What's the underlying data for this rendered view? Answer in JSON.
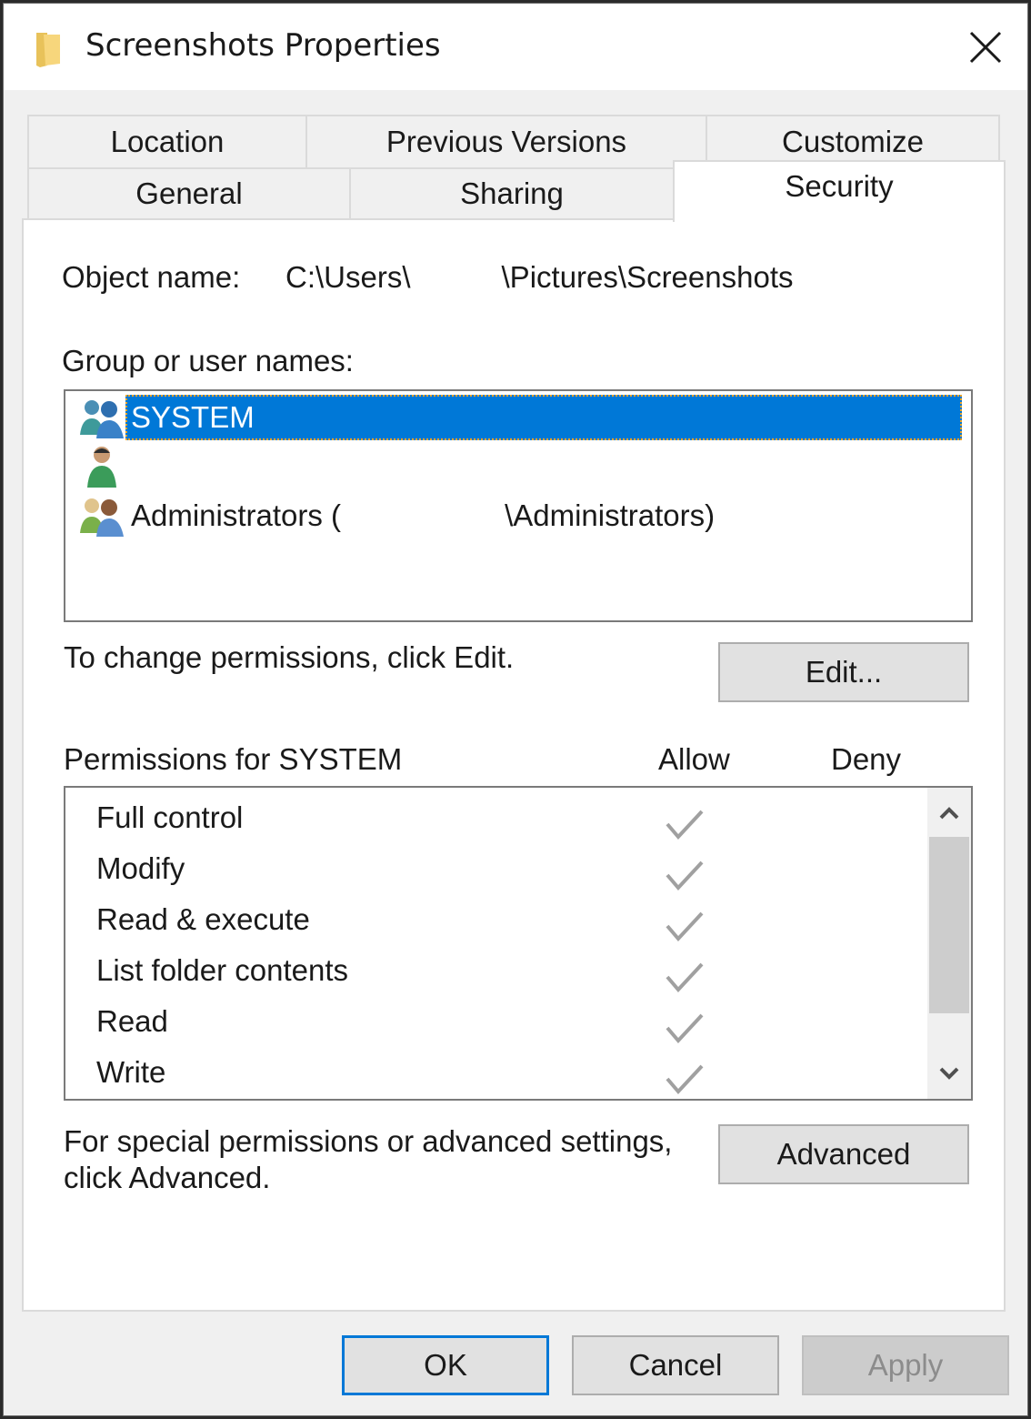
{
  "window": {
    "title": "Screenshots Properties",
    "icon": "folder-icon",
    "close_icon": "close-icon"
  },
  "tabs": {
    "row1": [
      {
        "label": "Location",
        "active": false
      },
      {
        "label": "Previous Versions",
        "active": false
      },
      {
        "label": "Customize",
        "active": false
      }
    ],
    "row2": [
      {
        "label": "General",
        "active": false
      },
      {
        "label": "Sharing",
        "active": false
      },
      {
        "label": "Security",
        "active": true
      }
    ]
  },
  "security": {
    "object_name_label": "Object name:",
    "object_name_prefix": "C:\\Users\\",
    "object_name_suffix": "\\Pictures\\Screenshots",
    "group_label": "Group or user names:",
    "users": [
      {
        "name": "SYSTEM",
        "icon": "group-icon",
        "selected": true
      },
      {
        "name": "",
        "icon": "user-icon",
        "selected": false
      },
      {
        "name_prefix": "Administrators (",
        "name_suffix": "\\Administrators)",
        "icon": "group-icon",
        "selected": false
      }
    ],
    "change_hint": "To change permissions, click Edit.",
    "edit_button": "Edit...",
    "permissions_label": "Permissions for SYSTEM",
    "allow_header": "Allow",
    "deny_header": "Deny",
    "permissions": [
      {
        "name": "Full control",
        "allow": true,
        "deny": false
      },
      {
        "name": "Modify",
        "allow": true,
        "deny": false
      },
      {
        "name": "Read & execute",
        "allow": true,
        "deny": false
      },
      {
        "name": "List folder contents",
        "allow": true,
        "deny": false
      },
      {
        "name": "Read",
        "allow": true,
        "deny": false
      },
      {
        "name": "Write",
        "allow": true,
        "deny": false
      }
    ],
    "advanced_hint_line1": "For special permissions or advanced settings,",
    "advanced_hint_line2": "click Advanced.",
    "advanced_button": "Advanced"
  },
  "footer": {
    "ok": "OK",
    "cancel": "Cancel",
    "apply": "Apply",
    "apply_disabled": true
  },
  "colors": {
    "selection": "#0078d7",
    "focus_outline": "#f5a623",
    "check": "#a0a0a0"
  }
}
